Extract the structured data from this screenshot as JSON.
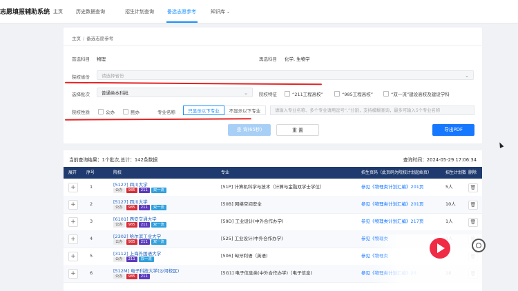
{
  "header": {
    "brand": "志愿填报辅助系统",
    "nav": [
      {
        "label": "主页"
      },
      {
        "label": "历史数据查询"
      },
      {
        "label": "招生计划查询"
      },
      {
        "label": "备选志愿参考",
        "active": true
      },
      {
        "label": "知识库"
      }
    ]
  },
  "breadcrumb": {
    "home": "主页",
    "sep": "/",
    "current": "备选志愿参考"
  },
  "form": {
    "primary_subject_label": "首选科目",
    "primary_subject_value": "物理",
    "secondary_subject_label": "再选科目",
    "secondary_subject_value": "化学, 生物学",
    "province_label": "院校省份",
    "province_placeholder": "请选择省份",
    "batch_label": "选择批次",
    "batch_value": "普通类本科批",
    "feature_label": "院校特征",
    "feature_options": [
      "“211工程高校”",
      "“985工程高校”",
      "“双一流”建设高校及建设学科"
    ],
    "nature_label": "院校性质",
    "nature_options": [
      "公办",
      "民办"
    ],
    "major_label": "专业名称",
    "mode_show": "只显示以下专业",
    "mode_hide": "不显示以下专业",
    "keyword_placeholder": "请输入专业名称、多个专业请用逗号“,”分割，支持模糊查询，最多可输入5个专业名称"
  },
  "buttons": {
    "query": "查 询(65秒)",
    "reset": "重 置",
    "export": "导出PDF"
  },
  "results": {
    "summary": "当前查询结果：1个批次,总计：142条数据",
    "time": "查询时间：2024-05-29 17:06:34",
    "columns": [
      "展开",
      "序号",
      "院校",
      "专业",
      "招生页码（此页码为院校计划起始页）",
      "招生计划数",
      "删除"
    ],
    "rows": [
      {
        "idx": "1",
        "school": "[5127] 四川大学",
        "tags": [
          "公办",
          "985",
          "211",
          "双一流"
        ],
        "major": "[51P] 计算机科学与技术（计算与金融双学士学位）",
        "ref": "参见《物理类计划汇编》201页",
        "count": "5人"
      },
      {
        "idx": "2",
        "school": "[5127] 四川大学",
        "tags": [
          "公办",
          "985",
          "211",
          "双一流"
        ],
        "major": "[50B] 网络空间安全",
        "ref": "参见《物理类计划汇编》201页",
        "count": "10人"
      },
      {
        "idx": "3",
        "school": "[6101] 西安交通大学",
        "tags": [
          "公办",
          "985",
          "211",
          "双一流"
        ],
        "major": "[59D] 工业设计(中外合作办学)",
        "ref": "参见《物理类计划汇编》217页",
        "count": "1人"
      },
      {
        "idx": "4",
        "school": "[2302] 哈尔滨工业大学",
        "tags": [
          "公办",
          "985",
          "211",
          "双一流"
        ],
        "major": "[525] 工业设计(中外合作办学)",
        "ref": "参见《物理类",
        "count": "1人"
      },
      {
        "idx": "5",
        "school": "[3112] 上海外国语大学",
        "tags": [
          "公办",
          "211",
          "双一流"
        ],
        "major": "[506] 匈牙利语（英语)",
        "ref": "参见《物理类",
        "count": "人"
      },
      {
        "idx": "6",
        "school": "[512M] 电子科技大学(沙河校区)",
        "tags": [
          "公办",
          "985",
          "211"
        ],
        "major": "[5G1] 电子信息类(中外合作办学)（电子信息)",
        "ref": "参见《物理类计划汇编》20",
        "count": "18"
      }
    ]
  },
  "colors": {
    "accent": "#1890ff",
    "table_header": "#1f3a6e",
    "annotation": "#e52222"
  }
}
